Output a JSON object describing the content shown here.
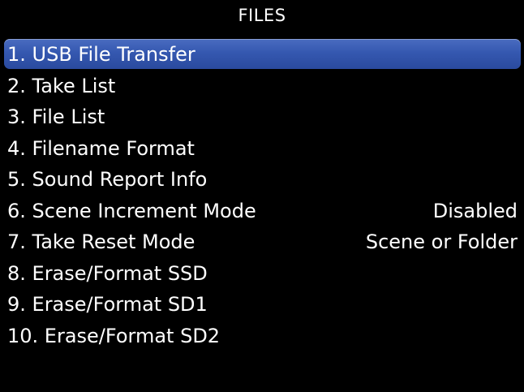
{
  "screen": {
    "title": "FILES"
  },
  "menu": {
    "items": [
      {
        "label": "1. USB File Transfer",
        "value": "",
        "selected": true
      },
      {
        "label": "2. Take List",
        "value": ""
      },
      {
        "label": "3. File List",
        "value": ""
      },
      {
        "label": "4. Filename Format",
        "value": ""
      },
      {
        "label": "5. Sound Report Info",
        "value": ""
      },
      {
        "label": "6. Scene Increment Mode",
        "value": "Disabled"
      },
      {
        "label": "7. Take Reset Mode",
        "value": "Scene or Folder"
      },
      {
        "label": "8. Erase/Format SSD",
        "value": ""
      },
      {
        "label": "9. Erase/Format SD1",
        "value": ""
      },
      {
        "label": "10. Erase/Format SD2",
        "value": ""
      }
    ]
  },
  "colors": {
    "background": "#000000",
    "text": "#ffffff",
    "highlight": "#3558b0"
  }
}
